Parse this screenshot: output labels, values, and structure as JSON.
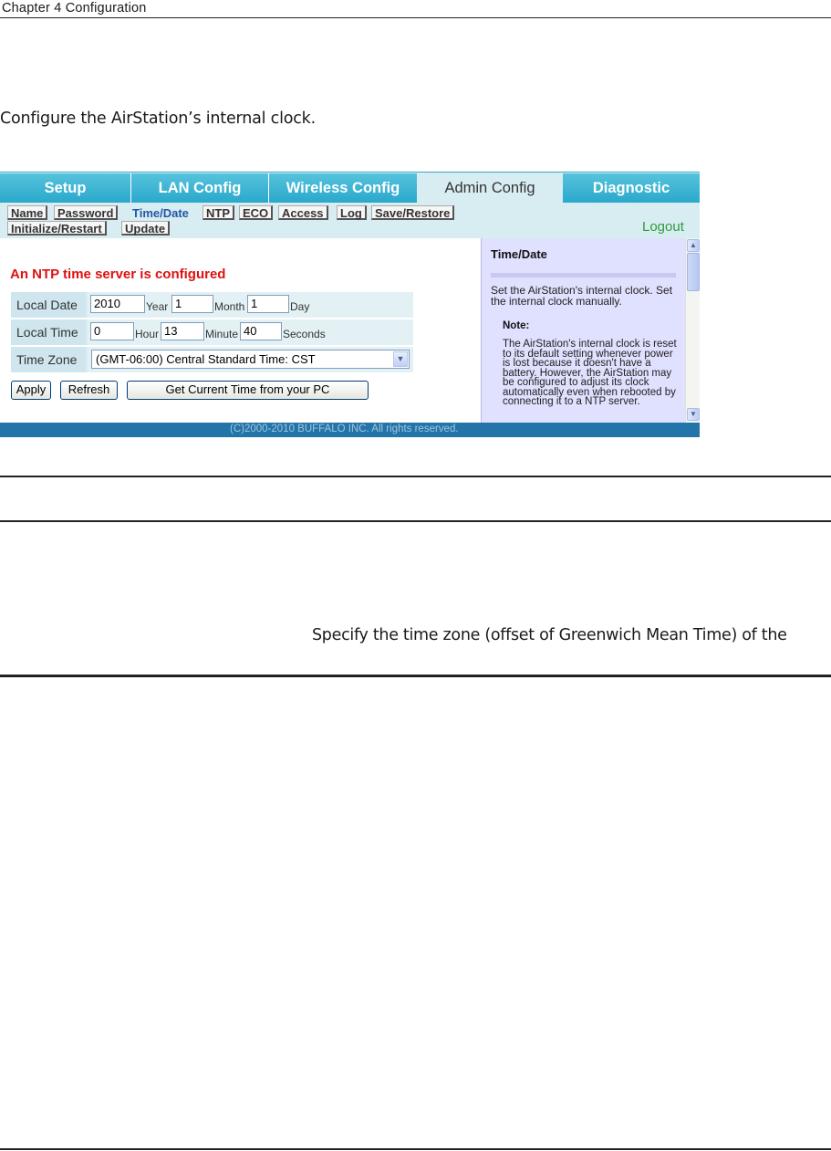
{
  "document": {
    "chapter_header": "Chapter 4  Configuration",
    "intro": "Configure the AirStation’s internal clock.",
    "spec_text": "Specify the time zone (offset of Greenwich Mean Time) of the"
  },
  "app": {
    "tabs": [
      "Setup",
      "LAN Config",
      "Wireless Config",
      "Admin Config",
      "Diagnostic"
    ],
    "active_tab": "Admin Config",
    "subnav": [
      "Name",
      "Password",
      "Time/Date",
      "NTP",
      "ECO",
      "Access",
      "Log",
      "Save/Restore",
      "Initialize/Restart",
      "Update"
    ],
    "active_subnav": "Time/Date",
    "logout": "Logout",
    "ntp_message": "An NTP time server is configured",
    "form": {
      "local_date_label": "Local Date",
      "year_value": "2010",
      "year_unit": "Year",
      "month_value": "1",
      "month_unit": "Month",
      "day_value": "1",
      "day_unit": "Day",
      "local_time_label": "Local Time",
      "hour_value": "0",
      "hour_unit": "Hour",
      "minute_value": "13",
      "minute_unit": "Minute",
      "seconds_value": "40",
      "seconds_unit": "Seconds",
      "time_zone_label": "Time Zone",
      "time_zone_value": "(GMT-06:00) Central Standard Time: CST"
    },
    "buttons": {
      "apply": "Apply",
      "refresh": "Refresh",
      "get_time": "Get Current Time from your PC"
    },
    "help": {
      "title": "Time/Date",
      "text": "Set the AirStation's internal clock. Set the internal clock manually.",
      "note_title": "Note:",
      "note": "The AirStation's internal clock is reset to its default setting whenever power is lost because it doesn't have a battery. However, the AirStation may be configured to adjust its clock automatically even when rebooted by connecting it to a NTP server."
    },
    "footer": "(C)2000-2010 BUFFALO INC. All rights reserved.",
    "colors": {
      "tab_blue": "#2aa8cb",
      "panel_bg": "#d8edf2",
      "alert_red": "#e01010",
      "logout_green": "#2e9a3a",
      "help_bg": "#e0e0ff",
      "footer_blue": "#2374a8"
    }
  }
}
